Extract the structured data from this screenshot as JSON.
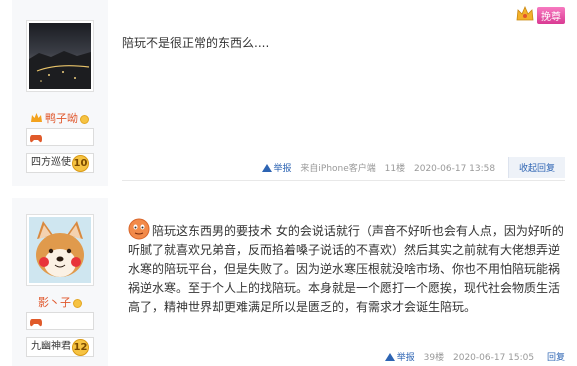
{
  "posts": [
    {
      "username": "鸭子呦",
      "rank_title": "四方巡使",
      "rank_level": "10",
      "text": "陪玩不是很正常的东西么....",
      "report_label": "举报",
      "source": "来自iPhone客户端",
      "floor": "11楼",
      "datetime": "2020-06-17 13:58",
      "reply_label": "收起回复",
      "vip_label": "挽尊"
    },
    {
      "username": "影丶子",
      "rank_title": "九幽神君",
      "rank_level": "12",
      "text": "陪玩这东西男的要技术 女的会说话就行（声音不好听也会有人点，因为好听的听腻了就喜欢兄弟音，反而掐着嗓子说话的不喜欢）然后其实之前就有大佬想弄逆水寒的陪玩平台，但是失败了。因为逆水寒压根就没啥市场、你也不用怕陪玩能祸祸逆水寒。至于个人上的找陪玩。本身就是一个愿打一个愿挨，现代社会物质生活高了，精神世界却更难满足所以是匮乏的，有需求才会诞生陪玩。",
      "report_label": "举报",
      "floor": "39楼",
      "datetime": "2020-06-17 15:05",
      "reply_label": "回复"
    }
  ],
  "colors": {
    "link": "#2d64b3",
    "username": "#e0572c",
    "author_bg": "#f7f8fa"
  },
  "icons": [
    "crown-icon",
    "gamepad-icon",
    "coin-icon",
    "report-icon",
    "emoticon-face-icon"
  ]
}
